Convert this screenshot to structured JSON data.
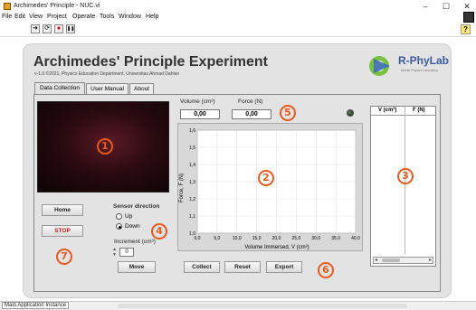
{
  "window": {
    "title": "Archimedes' Principle - NUC.vi",
    "controls": [
      "–",
      "☐",
      "✕"
    ]
  },
  "menu": [
    "File",
    "Edit",
    "View",
    "Project",
    "Operate",
    "Tools",
    "Window",
    "Help"
  ],
  "toolbar": {
    "icons": [
      "run-arrow-icon",
      "run-continuous-icon",
      "abort-icon",
      "pause-icon"
    ],
    "glyphs": [
      "➜",
      "⟳",
      "●",
      "❚❚"
    ],
    "help_glyph": "?"
  },
  "header": {
    "title": "Archimedes' Principle Experiment",
    "subtitle": "v-1.0 ©2021, Physics Education Department, Universitas Ahmad Dahlan",
    "logo_text": "R-PhyLab",
    "logo_tagline": "Mobile Physics Laboratory"
  },
  "tabs": [
    "Data Collection",
    "User Manual",
    "About"
  ],
  "badges": [
    "1",
    "2",
    "3",
    "4",
    "5",
    "6",
    "7"
  ],
  "buttons": {
    "home": "Home",
    "stop": "STOP",
    "move": "Move",
    "collect": "Collect",
    "reset": "Reset",
    "export": "Export"
  },
  "sensor": {
    "label": "Sensor direction",
    "options": [
      "Up",
      "Down"
    ],
    "selected": "Down",
    "increment_label": "Increment (cm³)",
    "increment_value": "0"
  },
  "readouts": {
    "volume_label": "Volume (cm³)",
    "volume_value": "0,00",
    "force_label": "Force (N)",
    "force_value": "0,00"
  },
  "table": {
    "columns": [
      "V (cm³)",
      "F (N)"
    ]
  },
  "chart_data": {
    "type": "line",
    "xlabel": "Volume Immersed, V (cm³)",
    "ylabel": "Force, F (N)",
    "xlim": [
      0,
      40
    ],
    "ylim": [
      1.0,
      1.6
    ],
    "xticks": [
      "0,0",
      "5,0",
      "10,0",
      "15,0",
      "20,0",
      "25,0",
      "30,0",
      "35,0",
      "40,0"
    ],
    "yticks": [
      "1,0",
      "1,1",
      "1,2",
      "1,3",
      "1,4",
      "1,5",
      "1,6"
    ],
    "grid": true,
    "series": []
  },
  "status": {
    "instance": "Main Application Instance"
  }
}
